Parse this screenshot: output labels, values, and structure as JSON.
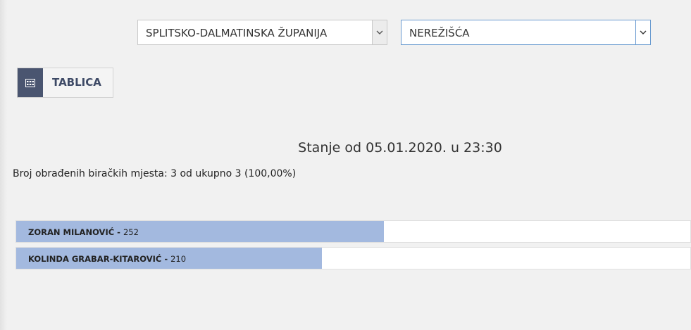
{
  "filters": {
    "county": "SPLITSKO-DALMATINSKA ŽUPANIJA",
    "municipality": "NEREŽIŠĆA"
  },
  "view_button": {
    "label": "TABLICA",
    "icon": "table-icon"
  },
  "status_text": "Stanje od 05.01.2020. u 23:30",
  "processed_text": "Broj obrađenih biračkih mjesta: 3 od ukupno 3 (100,00%)",
  "colors": {
    "bar_fill": "#a3b9df",
    "button_icon_bg": "#4a5570",
    "focus_border": "#6a9bd0"
  },
  "results": [
    {
      "name": "ZORAN MILANOVIĆ",
      "separator": " - ",
      "votes": "252",
      "share": 0.545
    },
    {
      "name": "KOLINDA GRABAR-KITAROVIĆ",
      "separator": " - ",
      "votes": "210",
      "share": 0.454
    }
  ]
}
